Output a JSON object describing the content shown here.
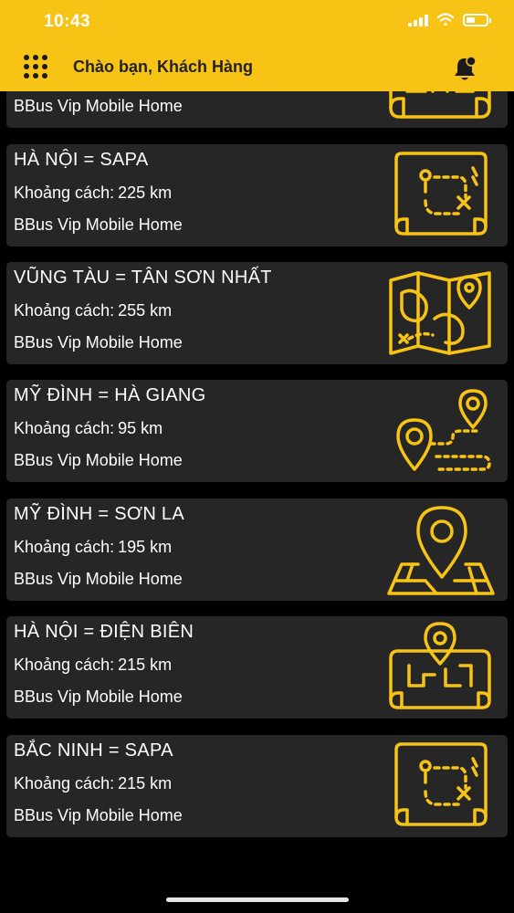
{
  "status_bar": {
    "time": "10:43"
  },
  "header": {
    "greeting": "Chào bạn, Khách Hàng"
  },
  "routes": [
    {
      "title": "",
      "distance_label": "",
      "distance_value": "",
      "provider": "BBus Vip Mobile Home",
      "icon": "map-scroll-icon"
    },
    {
      "title": "HÀ NỘI = SAPA",
      "distance_label": "Khoảng cách:",
      "distance_value": "225 km",
      "provider": "BBus Vip Mobile Home",
      "icon": "treasure-map-icon"
    },
    {
      "title": "VŨNG TÀU = TÂN SƠN NHẤT",
      "distance_label": "Khoảng cách:",
      "distance_value": "255 km",
      "provider": "BBus Vip Mobile Home",
      "icon": "world-map-pin-icon"
    },
    {
      "title": "MỸ ĐÌNH = HÀ GIANG",
      "distance_label": "Khoảng cách:",
      "distance_value": "95 km",
      "provider": "BBus Vip Mobile Home",
      "icon": "route-pins-icon"
    },
    {
      "title": "MỸ ĐÌNH = SƠN LA",
      "distance_label": "Khoảng cách:",
      "distance_value": "195 km",
      "provider": "BBus Vip Mobile Home",
      "icon": "location-pin-map-icon"
    },
    {
      "title": "HÀ NỘI = ĐIỆN BIÊN",
      "distance_label": "Khoảng cách:",
      "distance_value": "215 km",
      "provider": "BBus Vip Mobile Home",
      "icon": "map-scroll-pin-icon"
    },
    {
      "title": "BẮC NINH = SAPA",
      "distance_label": "Khoảng cách:",
      "distance_value": "215 km",
      "provider": "BBus Vip Mobile Home",
      "icon": "treasure-map-icon"
    }
  ],
  "colors": {
    "accent": "#f7c416",
    "card": "#262626",
    "background": "#000000",
    "text": "#ffffff"
  }
}
